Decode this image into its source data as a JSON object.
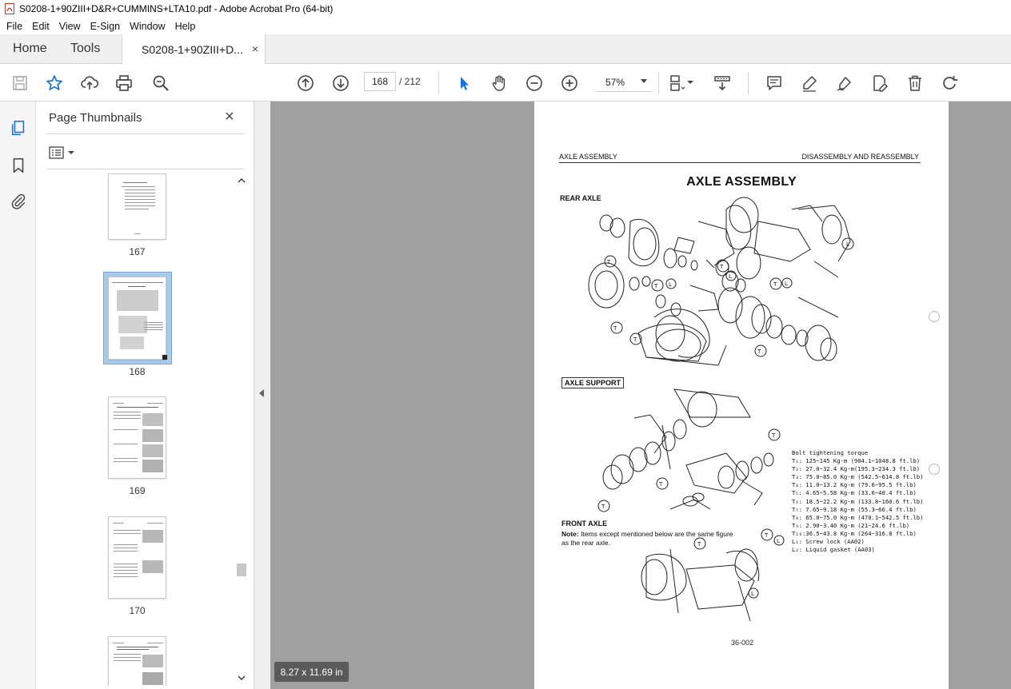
{
  "window": {
    "title": "S0208-1+90ZIII+D&R+CUMMINS+LTA10.pdf - Adobe Acrobat Pro (64-bit)"
  },
  "menu": [
    "File",
    "Edit",
    "View",
    "E-Sign",
    "Window",
    "Help"
  ],
  "tabs": {
    "home": "Home",
    "tools": "Tools",
    "document": "S0208-1+90ZIII+D...",
    "close": "×"
  },
  "toolbar": {
    "current_page": "168",
    "total_pages": "/ 212",
    "zoom": "57%",
    "icons": [
      "save-icon",
      "star-icon",
      "upload-icon",
      "print-icon",
      "zoom-search-icon",
      "page-up-icon",
      "page-down-icon",
      "select-arrow-icon",
      "hand-icon",
      "zoom-out-icon",
      "zoom-in-icon",
      "page-view-icon",
      "scroll-icon",
      "comment-icon",
      "highlight-icon",
      "sign-icon",
      "edit-icon",
      "delete-icon",
      "redo-icon"
    ]
  },
  "rail": {
    "icons": [
      "pages-icon",
      "bookmark-icon",
      "attachment-icon"
    ]
  },
  "thumbnails_panel": {
    "title": "Page Thumbnails",
    "close": "×",
    "pages": [
      {
        "label": "167",
        "selected": false
      },
      {
        "label": "168",
        "selected": true
      },
      {
        "label": "169",
        "selected": false
      },
      {
        "label": "170",
        "selected": false
      }
    ]
  },
  "page": {
    "header_left": "AXLE ASSEMBLY",
    "header_right": "DISASSEMBLY AND REASSEMBLY",
    "title": "AXLE ASSEMBLY",
    "rear_axle": "REAR AXLE",
    "axle_support": "AXLE SUPPORT",
    "front_axle": "FRONT AXLE",
    "note_label": "Note:",
    "note_text": "Items except mentioned below are the same figure as the rear axle.",
    "torque_title": "Bolt tightening torque",
    "torque_lines": [
      "T₁: 125∼145 Kg·m (904.1∼1048.8 ft.lb)",
      "T₂: 27.0∼32.4 Kg·m(195.3∼234.3 ft.lb)",
      "T₃: 75.0∼85.0 Kg·m (542.5∼614.8 ft.lb)",
      "T₄: 11.0∼13.2 Kg·m (79.6∼95.5 ft.lb)",
      "T₅: 4.65∼5.58 Kg·m (33.6∼40.4 ft.lb)",
      "T₆: 18.5∼22.2 Kg·m (133.8∼160.6 ft.lb)",
      "T₇: 7.65∼9.18 Kg·m (55.3∼66.4 ft.lb)",
      "T₈: 65.0∼75.0 Kg·m (470.1∼542.5 ft.lb)",
      "T₉: 2.90∼3.40 Kg·m (21∼24.6 ft.lb)",
      "T₁₀:36.5∼43.8 Kg·m (264∼316.8 ft.lb)",
      "L₁: Screw lock (AA02)",
      "L₂: Liquid gasket (AA03)"
    ],
    "footer": "36-002"
  },
  "page_size_tip": "8.27 x 11.69 in",
  "colors": {
    "accent_blue": "#1473e6",
    "doc_background": "#a0a0a0",
    "selected_thumb": "#a8cbe9"
  }
}
